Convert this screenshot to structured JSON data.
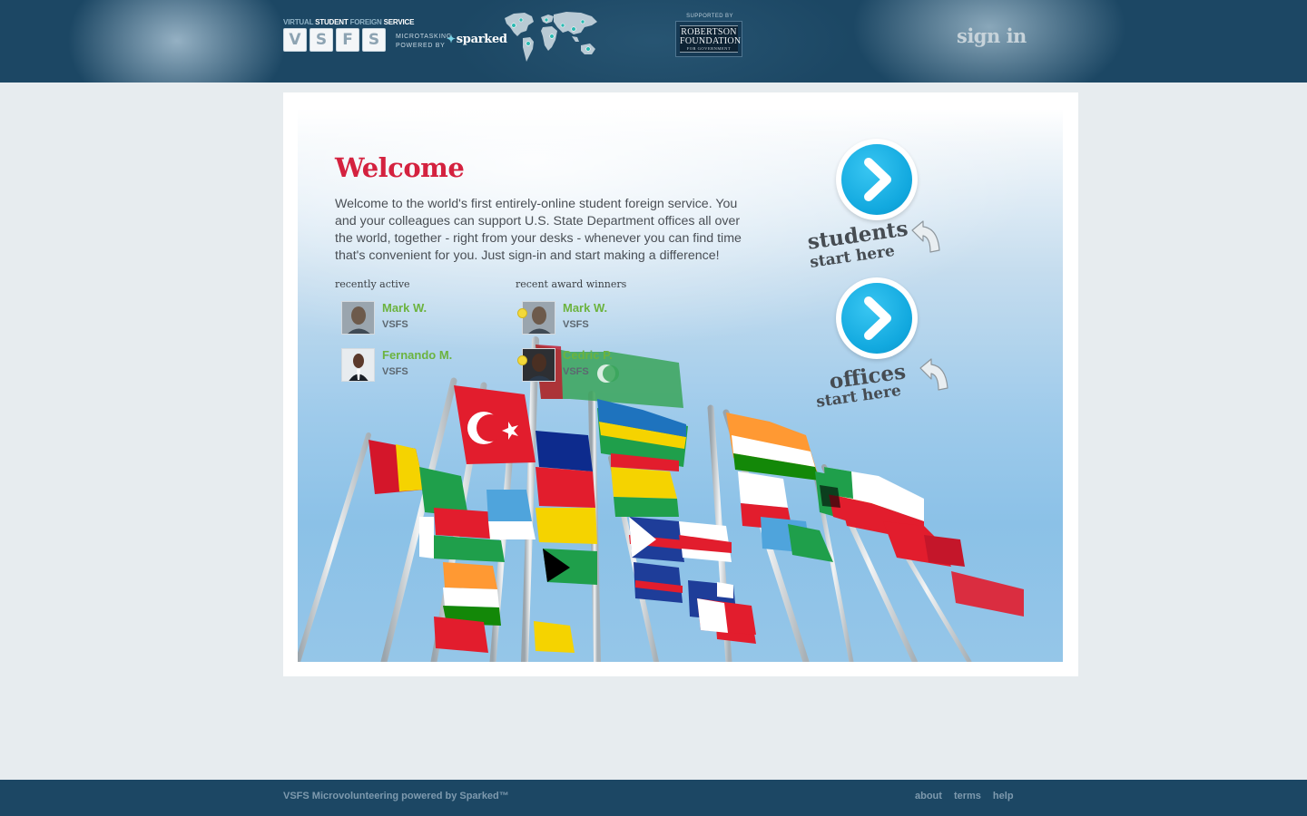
{
  "header": {
    "logo_top_a": "VIRTUAL ",
    "logo_top_b": "STUDENT ",
    "logo_top_c": "FOREIGN ",
    "logo_top_d": "SERVICE",
    "logo_letters": [
      "V",
      "S",
      "F",
      "S"
    ],
    "microtasking": "MICROTASKING",
    "powered_by": "POWERED BY",
    "sparked": "sparked",
    "supported_by": "SUPPORTED BY",
    "robertson_line1": "ROBERTSON",
    "robertson_line2": "FOUNDATION",
    "robertson_line3": "FOR GOVERNMENT",
    "signin": "sign in"
  },
  "welcome": {
    "title": "Welcome",
    "text": "Welcome to the world's first entirely-online student foreign service. You and your colleagues can support U.S. State Department offices all over the world, together - right from your desks - whenever you can find time that's convenient for you. Just sign-in and start making a difference!"
  },
  "recently_active": {
    "label": "recently active",
    "members": [
      {
        "name": "Mark W.",
        "org": "VSFS"
      },
      {
        "name": "Fernando M.",
        "org": "VSFS"
      }
    ]
  },
  "award_winners": {
    "label": "recent award winners",
    "members": [
      {
        "name": "Mark W.",
        "org": "VSFS"
      },
      {
        "name": "Cedric P.",
        "org": "VSFS"
      }
    ]
  },
  "cta": {
    "students_big": "students",
    "students_small": "start here",
    "offices_big": "offices",
    "offices_small": "start here"
  },
  "footer": {
    "text": "VSFS Microvolunteering powered by Sparked™",
    "links": [
      "about",
      "terms",
      "help"
    ]
  },
  "colors": {
    "header_bg": "#1c4764",
    "welcome_red": "#d4223f",
    "name_green": "#6cb33f",
    "cta_blue": "#12a9df"
  },
  "icons": [
    "world-map-icon",
    "arrow-right-icon",
    "curved-arrow-icon",
    "award-dot-icon"
  ]
}
